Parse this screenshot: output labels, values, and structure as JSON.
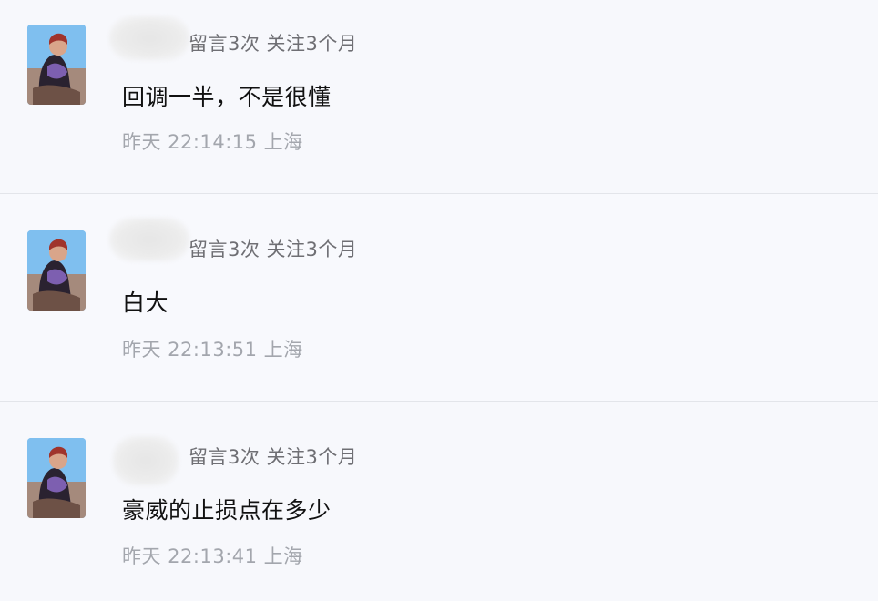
{
  "comments": [
    {
      "meta": "留言3次 关注3个月",
      "text": "回调一半，不是很懂",
      "time": "昨天 22:14:15 上海"
    },
    {
      "meta": "留言3次 关注3个月",
      "text": "白大",
      "time": "昨天 22:13:51 上海"
    },
    {
      "meta": "留言3次 关注3个月",
      "text": "豪威的止损点在多少",
      "time": "昨天 22:13:41 上海"
    }
  ],
  "icons": {
    "avatar": "user-avatar-icon"
  }
}
